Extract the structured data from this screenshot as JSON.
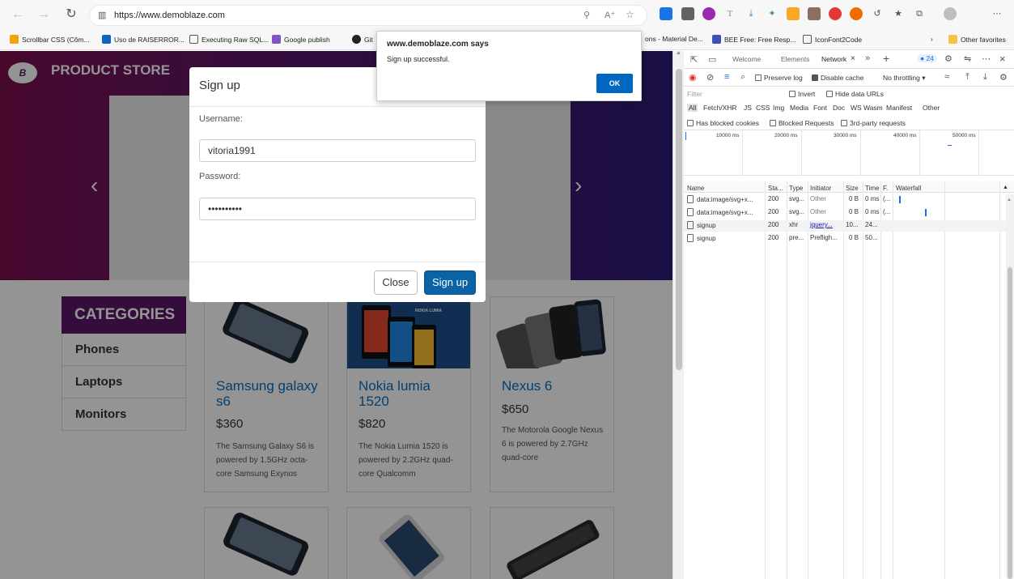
{
  "browser": {
    "url": "https://www.demoblaze.com",
    "bookmarks": [
      "Scrollbar CSS (Côm...",
      "Uso de RAISERROR...",
      "Executing Raw SQL...",
      "Google publish",
      "Git",
      "ons - Material De...",
      "BEE Free: Free Resp...",
      "IconFont2Code",
      "Other favorites"
    ]
  },
  "store": {
    "brand_logo": "B",
    "brand_name": "PRODUCT STORE",
    "categories_title": "CATEGORIES",
    "categories": [
      "Phones",
      "Laptops",
      "Monitors"
    ],
    "products": [
      {
        "title": "Samsung galaxy s6",
        "price": "$360",
        "desc": "The Samsung Galaxy S6 is powered by 1.5GHz octa-core Samsung Exynos"
      },
      {
        "title": "Nokia lumia 1520",
        "price": "$820",
        "desc": "The Nokia Lumia 1520 is powered by 2.2GHz quad-core Qualcomm"
      },
      {
        "title": "Nexus 6",
        "price": "$650",
        "desc": "The Motorola Google Nexus 6 is powered by 2.7GHz quad-core"
      }
    ],
    "nokia_banner_text": "NOKIA LUMIA"
  },
  "modal": {
    "title": "Sign up",
    "username_label": "Username:",
    "username_value": "vitoria1991",
    "password_label": "Password:",
    "password_value": "••••••••••",
    "close_label": "Close",
    "signup_label": "Sign up"
  },
  "alert": {
    "title": "www.demoblaze.com says",
    "message": "Sign up successful.",
    "ok_label": "OK"
  },
  "devtools": {
    "tabs": [
      "Welcome",
      "Elements",
      "Network"
    ],
    "issue_count": "24",
    "preserve_log": "Preserve log",
    "disable_cache": "Disable cache",
    "throttling": "No throttling",
    "filter_placeholder": "Filter",
    "invert": "Invert",
    "hide_data_urls": "Hide data URLs",
    "type_filters": [
      "All",
      "Fetch/XHR",
      "JS",
      "CSS",
      "Img",
      "Media",
      "Font",
      "Doc",
      "WS",
      "Wasm",
      "Manifest",
      "Other"
    ],
    "blocked_cookies": "Has blocked cookies",
    "blocked_requests": "Blocked Requests",
    "third_party": "3rd-party requests",
    "timeline_ticks": [
      "10000 ms",
      "20000 ms",
      "30000 ms",
      "40000 ms",
      "50000 ms"
    ],
    "columns": [
      "Name",
      "Sta...",
      "Type",
      "Initiator",
      "Size",
      "Time",
      "F.",
      "Waterfall"
    ],
    "rows": [
      {
        "name": "data:image/svg+x...",
        "status": "200",
        "type": "svg...",
        "initiator": "Other",
        "size": "0 B",
        "time": "0 ms",
        "f": "(..."
      },
      {
        "name": "data:image/svg+x...",
        "status": "200",
        "type": "svg...",
        "initiator": "Other",
        "size": "0 B",
        "time": "0 ms",
        "f": "(..."
      },
      {
        "name": "signup",
        "status": "200",
        "type": "xhr",
        "initiator": "jquery...",
        "size": "10...",
        "time": "24...",
        "f": ""
      },
      {
        "name": "signup",
        "status": "200",
        "type": "pre...",
        "initiator": "Prefligh...",
        "size": "0 B",
        "time": "50...",
        "f": ""
      }
    ]
  },
  "colors": {
    "brand": "#5b1769",
    "link": "#0a6ebd",
    "primary_button": "#0b62a4",
    "alert_ok": "#0067c0"
  }
}
